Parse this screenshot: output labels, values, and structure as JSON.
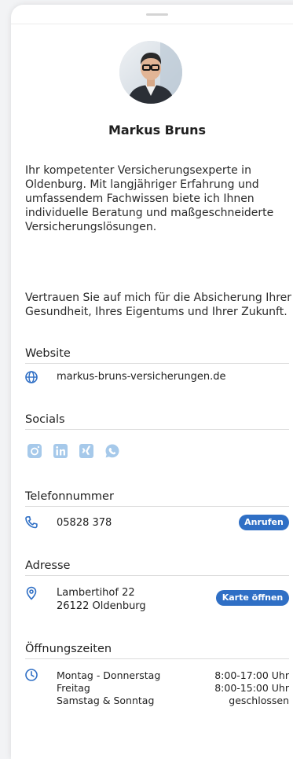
{
  "profile": {
    "name": "Markus Bruns"
  },
  "bio": {
    "paragraph1": "Ihr kompetenter Versicherungsexperte in Oldenburg. Mit langjähriger Erfahrung und umfassendem Fachwissen biete ich Ihnen individuelle Beratung und maßgeschneiderte Versicherungslösungen.",
    "paragraph2": "Vertrauen Sie auf mich für die Absicherung Ihrer Gesundheit, Ihres Eigentums und Ihrer Zukunft."
  },
  "website": {
    "title": "Website",
    "url": "markus-bruns-versicherungen.de",
    "icon": "globe-icon"
  },
  "socials": {
    "title": "Socials",
    "items": [
      "instagram-icon",
      "linkedin-icon",
      "xing-icon",
      "whatsapp-icon"
    ],
    "color": "#a6c9ea"
  },
  "phone": {
    "title": "Telefonnummer",
    "number": "05828 378",
    "button": "Anrufen",
    "icon": "phone-icon"
  },
  "address": {
    "title": "Adresse",
    "line1": "Lambertihof 22",
    "line2": "26122 Oldenburg",
    "button": "Karte öffnen",
    "icon": "location-pin-icon"
  },
  "hours": {
    "title": "Öffnungszeiten",
    "icon": "clock-icon",
    "rows": [
      {
        "day": "Montag - Donnerstag",
        "time": "8:00-17:00 Uhr"
      },
      {
        "day": "Freitag",
        "time": "8:00-15:00 Uhr"
      },
      {
        "day": "Samstag & Sonntag",
        "time": "geschlossen"
      }
    ]
  },
  "colors": {
    "accent": "#2f6fc5",
    "social": "#a6c9ea"
  }
}
